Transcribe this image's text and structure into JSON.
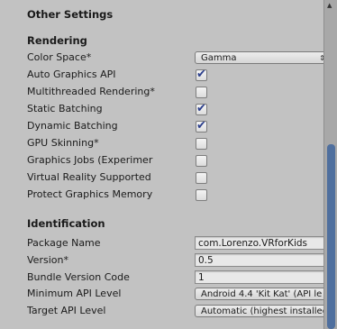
{
  "section": {
    "title": "Other Settings"
  },
  "rendering": {
    "title": "Rendering",
    "color_space": {
      "label": "Color Space*",
      "value": "Gamma"
    },
    "checks": [
      {
        "label": "Auto Graphics API",
        "checked": true
      },
      {
        "label": "Multithreaded Rendering*",
        "checked": false
      },
      {
        "label": "Static Batching",
        "checked": true
      },
      {
        "label": "Dynamic Batching",
        "checked": true
      },
      {
        "label": "GPU Skinning*",
        "checked": false
      },
      {
        "label": "Graphics Jobs (Experimer",
        "checked": false
      },
      {
        "label": "Virtual Reality Supported",
        "checked": false
      },
      {
        "label": "Protect Graphics Memory",
        "checked": false
      }
    ]
  },
  "identification": {
    "title": "Identification",
    "package_name": {
      "label": "Package Name",
      "value": "com.Lorenzo.VRforKids"
    },
    "version": {
      "label": "Version*",
      "value": "0.5"
    },
    "bundle_version_code": {
      "label": "Bundle Version Code",
      "value": "1"
    },
    "min_api": {
      "label": "Minimum API Level",
      "value": "Android 4.4 'Kit Kat' (API le"
    },
    "target_api": {
      "label": "Target API Level",
      "value": "Automatic (highest installed"
    }
  },
  "icons": {
    "check": "checkmark-icon",
    "dropdown_arrow": "updown-arrow-icon"
  },
  "colors": {
    "scroll_thumb": "#4f6f9e",
    "check": "#2c3f8c",
    "background": "#c2c2c2"
  }
}
